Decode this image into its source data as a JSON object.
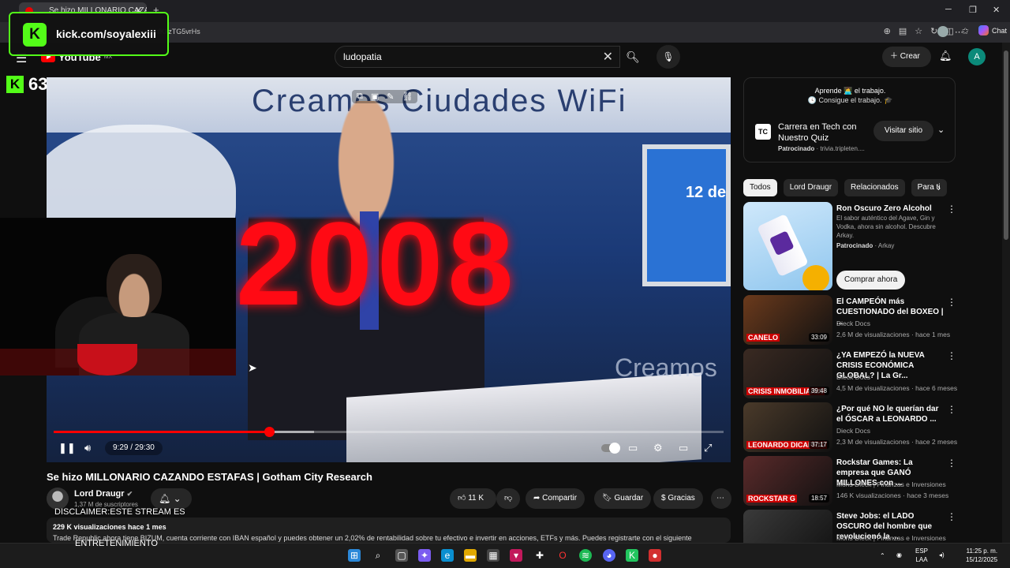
{
  "browser": {
    "tab_title": "Se hizo MILLONARIO CAZANDO...",
    "new_tab": "+",
    "url": "=fKkzTG5vrHs",
    "chat_label": "Chat"
  },
  "kick": {
    "logo_letter": "K",
    "channel": "kick.com/soyalexiii",
    "viewer_count": "63"
  },
  "youtube": {
    "logo_text": "YouTube",
    "region": "MX",
    "search_value": "ludopatia",
    "create_label": "Crear",
    "user_initial": "A"
  },
  "video": {
    "overlay_year": "2008",
    "banner_text": "Creamos Ciudades WiFi",
    "screen_text": "12 de",
    "creamos_text": "Creamos",
    "time": "9:29 / 29:30",
    "progress": 0.322,
    "title": "Se hizo MILLONARIO CAZANDO ESTAFAS | Gotham City Research",
    "channel": "Lord Draugr",
    "subscribers": "1,37 M de suscriptores",
    "likes": "11 K",
    "share": "Compartir",
    "save": "Guardar",
    "thanks": "Gracias",
    "views_line": "229 K visualizaciones hace 1 mes",
    "description": "Trade Republic ahora tiene BIZUM, cuenta corriente con IBAN español y puedes obtener un 2,02% de rentabilidad sobre tu efectivo e invertir en acciones, ETFs y más. Puedes registrarte con el siguiente"
  },
  "stream_overlay": {
    "disclaimer": "DISCLAIMER:ESTE STREAM ES",
    "entertainment": "ENTRETENIMIENTO"
  },
  "ad": {
    "tagline1": "Aprende 👩‍💻 el trabajo.",
    "tagline2": "🕓 Consigue el trabajo. 🎓",
    "logo": "TC",
    "headline": "Carrera en Tech con Nuestro Quiz",
    "sponsored": "Patrocinado",
    "domain": "trivia.tripleten....",
    "visit": "Visitar sitio"
  },
  "chips": [
    "Todos",
    "Lord Draugr",
    "Relacionados",
    "Para ti"
  ],
  "ad_rec": {
    "title": "Ron Oscuro Zero Alcohol",
    "desc": "El sabor auténtico del Agave, Gin y Vodka, ahora sin alcohol. Descubre Arkay.",
    "sponsored": "Patrocinado",
    "brand": "Arkay",
    "cta": "Comprar ahora"
  },
  "recommendations": [
    {
      "title": "El CAMPEÓN más CUESTIONADO del BOXEO | ...",
      "channel": "Dieck Docs",
      "meta": "2,6 M de visualizaciones · hace 1 mes",
      "duration": "33:09",
      "thumb_text": "CANELO",
      "color": "#6b3a1c"
    },
    {
      "title": "¿YA EMPEZÓ la NUEVA CRISIS ECONÓMICA GLOBAL? | La Gr...",
      "channel": "Dieck Docs",
      "meta": "4,5 M de visualizaciones · hace 6 meses",
      "duration": "39:48",
      "thumb_text": "CRISIS INMOBILIARIA",
      "color": "#3a2a22"
    },
    {
      "title": "¿Por qué NO le querían dar el ÓSCAR a LEONARDO ...",
      "channel": "Dieck Docs",
      "meta": "2,3 M de visualizaciones · hace 2 meses",
      "duration": "37:17",
      "thumb_text": "LEONARDO DICAPRIO",
      "color": "#4a3a2a"
    },
    {
      "title": "Rockstar Games: La empresa que GANÓ MILLONES con ...",
      "channel": "Moris Dieck | Finanzas e Inversiones",
      "meta": "146 K visualizaciones · hace 3 meses",
      "duration": "18:57",
      "thumb_text": "ROCKSTAR G",
      "color": "#5a2a2a"
    },
    {
      "title": "Steve Jobs: el LADO OSCURO del hombre que revolucionó la ...",
      "channel": "Moris Dieck | Finanzas e Inversiones",
      "meta": "",
      "duration": "",
      "thumb_text": "",
      "color": "#3a3a3a"
    }
  ],
  "taskbar": {
    "lang1": "ESP",
    "lang2": "LAA",
    "time": "11:25 p. m.",
    "date": "15/12/2025"
  },
  "colors": {
    "kick_green": "#53fc18",
    "youtube_red": "#ff0000",
    "overlay_red": "#ff0a14"
  }
}
